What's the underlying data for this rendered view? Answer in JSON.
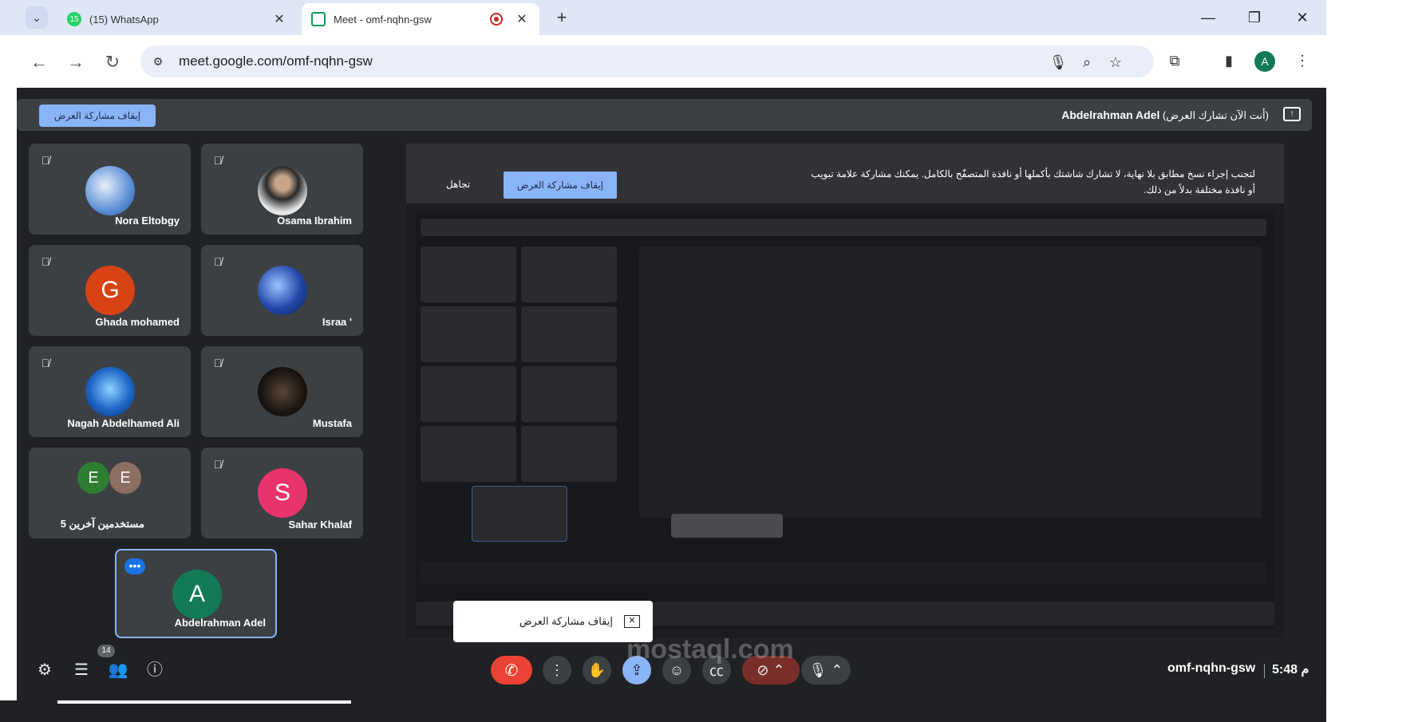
{
  "browser": {
    "tabs": [
      {
        "label": "(15) WhatsApp",
        "badge": "15"
      },
      {
        "label": "Meet - omf-nqhn-gsw"
      }
    ],
    "url": "meet.google.com/omf-nqhn-gsw",
    "profile_initial": "A"
  },
  "meet": {
    "presenting_bar": {
      "stop_label": "إيقاف مشاركة العرض",
      "presenter": "Abdelrahman Adel",
      "note": "(أنت الآن تشارك العرض)"
    },
    "participants": [
      {
        "name": "Nora Eltobgy",
        "initial": ""
      },
      {
        "name": "Osama Ibrahim",
        "initial": ""
      },
      {
        "name": "Ghada mohamed",
        "initial": "G",
        "color": "#d84315"
      },
      {
        "name": "Israa '",
        "initial": ""
      },
      {
        "name": "Nagah Abdelhamed Ali",
        "initial": ""
      },
      {
        "name": "Mustafa",
        "initial": ""
      },
      {
        "name": "5 مستخدمين آخرين",
        "initial_a": "E",
        "initial_b": "E"
      },
      {
        "name": "Sahar Khalaf",
        "initial": "S",
        "color": "#e8336d"
      },
      {
        "name": "Abdelrahman Adel",
        "initial": "A",
        "color": "#137a55"
      }
    ],
    "shared_screen": {
      "notice": "لتجنب إجراء نسخ مطابق بلا نهاية، لا تشارك شاشتك بأكملها أو نافذة المتصفّح بالكامل. يمكنك مشاركة علامة تبويب أو نافذة مختلفة بدلاً من ذلك.",
      "stop_label": "إيقاف مشاركة العرض",
      "ignore_label": "تجاهل"
    },
    "popup_label": "إيقاف مشاركة العرض",
    "people_count": "14",
    "meeting_code": "omf-nqhn-gsw",
    "time": "5:48 م"
  },
  "watermark": "mostaql.com",
  "colors": {
    "meet_bg": "#202124",
    "accent": "#8ab4f8",
    "end_call": "#ea4335"
  }
}
